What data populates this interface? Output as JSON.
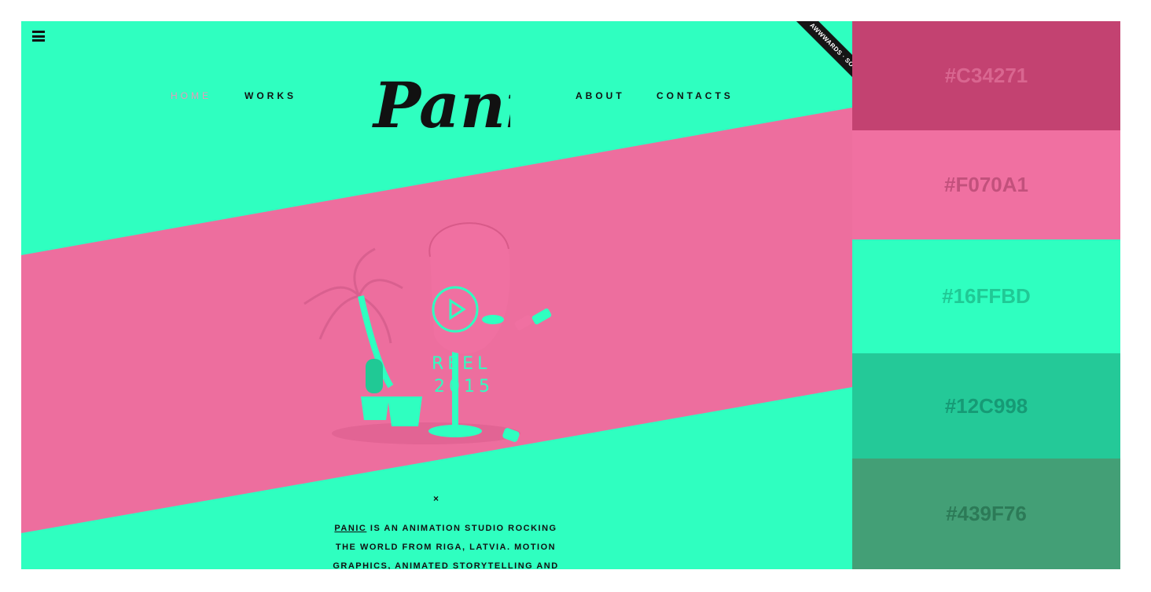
{
  "nav": {
    "home": "HOME",
    "works": "WORKS",
    "about": "ABOUT",
    "contacts": "CONTACTS"
  },
  "logo": {
    "text": "Panic"
  },
  "awards_ribbon": {
    "text": "AWWWARDS · SOTD"
  },
  "hero": {
    "reel_line1": "REEL",
    "reel_line2": "2015"
  },
  "intro": {
    "close": "×",
    "brand": "PANIC",
    "line1": " IS AN ANIMATION STUDIO ROCKING",
    "line2": "THE WORLD FROM RIGA, LATVIA. MOTION",
    "line3": "GRAPHICS, ANIMATED STORYTELLING AND"
  },
  "palette": [
    {
      "hex": "#C34271",
      "bg": "#C34271",
      "fg": "#D96690"
    },
    {
      "hex": "#F070A1",
      "bg": "#F070A1",
      "fg": "#C2517C"
    },
    {
      "hex": "#16FFBD",
      "bg": "#2FFFC0",
      "fg": "#20C995"
    },
    {
      "hex": "#12C998",
      "bg": "#24C998",
      "fg": "#169A75"
    },
    {
      "hex": "#439F76",
      "bg": "#439F76",
      "fg": "#2C7A57"
    }
  ],
  "colors": {
    "mint": "#2FFFC0",
    "pink": "#ED6E9E",
    "dark": "#111111"
  }
}
